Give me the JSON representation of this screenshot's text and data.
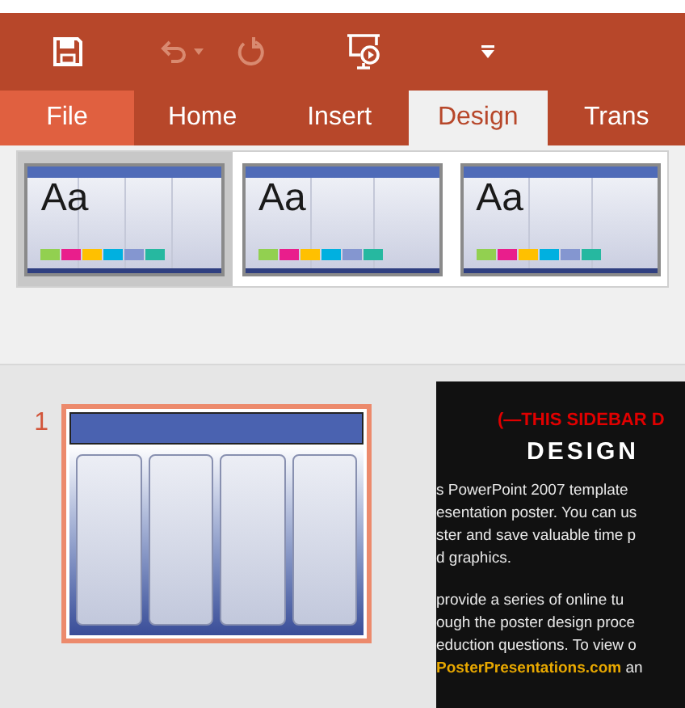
{
  "quick_access": [
    {
      "kind": "save",
      "disabled": false
    },
    {
      "kind": "undo",
      "disabled": true
    },
    {
      "kind": "repeat",
      "disabled": true
    },
    {
      "kind": "present",
      "disabled": false
    },
    {
      "kind": "customize",
      "disabled": false
    }
  ],
  "tabs": [
    {
      "label": "File",
      "kind": "file",
      "selected": false
    },
    {
      "label": "Home",
      "kind": "tab",
      "selected": false
    },
    {
      "label": "Insert",
      "kind": "tab",
      "selected": false
    },
    {
      "label": "Design",
      "kind": "tab",
      "selected": true
    },
    {
      "label": "Trans",
      "kind": "tab",
      "selected": false
    }
  ],
  "themes": [
    {
      "sample": "Aa",
      "selected": true
    },
    {
      "sample": "Aa",
      "selected": false
    },
    {
      "sample": "Aa",
      "selected": false
    }
  ],
  "slides": [
    {
      "number": "1",
      "selected": true
    }
  ],
  "slide": {
    "notice": "(—THIS SIDEBAR D",
    "heading": "DESIGN",
    "paragraph_1": [
      "s PowerPoint 2007 template",
      "esentation poster. You can us",
      "ster and save valuable time p",
      "d graphics."
    ],
    "paragraph_2": [
      " provide a series of online tu",
      "ough the poster design proce",
      "eduction questions. To view o"
    ],
    "link": "PosterPresentations.com",
    "link_tail": " an"
  }
}
